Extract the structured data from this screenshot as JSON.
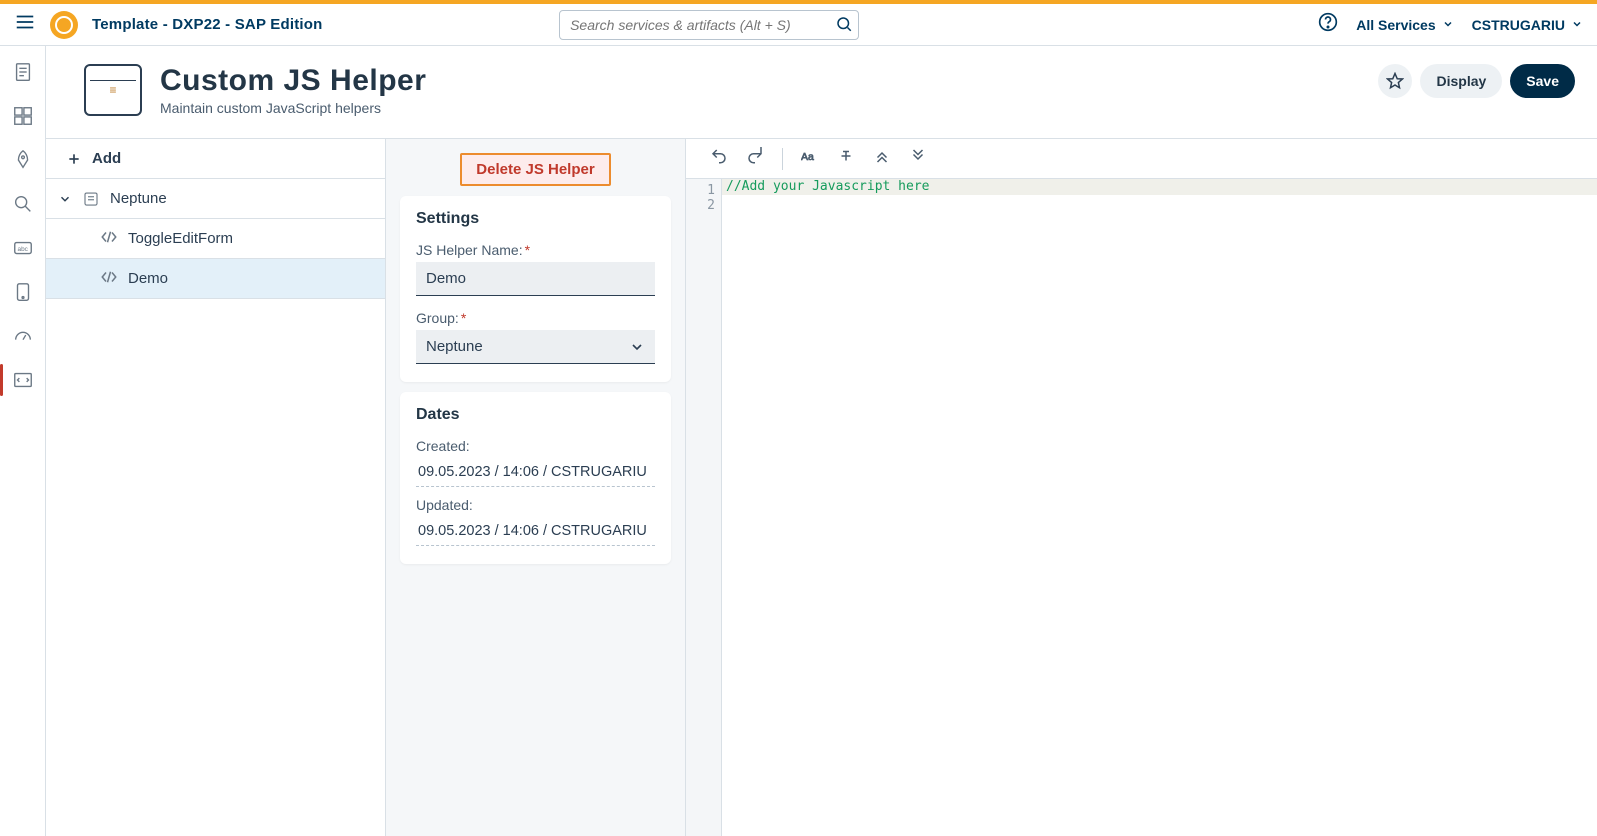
{
  "header": {
    "title": "Template - DXP22 - SAP Edition",
    "search_placeholder": "Search services & artifacts (Alt + S)",
    "all_services": "All Services",
    "user": "CSTRUGARIU"
  },
  "sidebar_icons": [
    "document",
    "grid",
    "rocket",
    "search",
    "abc",
    "device",
    "dial",
    "code"
  ],
  "page": {
    "title": "Custom JS Helper",
    "subtitle": "Maintain custom JavaScript helpers",
    "display": "Display",
    "save": "Save"
  },
  "tree": {
    "add": "Add",
    "group": "Neptune",
    "items": [
      "ToggleEditForm",
      "Demo"
    ],
    "selected": "Demo"
  },
  "settings": {
    "delete_label": "Delete JS Helper",
    "section_title": "Settings",
    "name_label": "JS Helper Name:",
    "name_value": "Demo",
    "group_label": "Group:",
    "group_value": "Neptune",
    "dates_title": "Dates",
    "created_label": "Created:",
    "created_value": "09.05.2023 / 14:06 / CSTRUGARIU",
    "updated_label": "Updated:",
    "updated_value": "09.05.2023 / 14:06 / CSTRUGARIU"
  },
  "editor": {
    "lines": [
      "//Add your Javascript here",
      ""
    ],
    "gutter": [
      "1",
      "2"
    ]
  }
}
